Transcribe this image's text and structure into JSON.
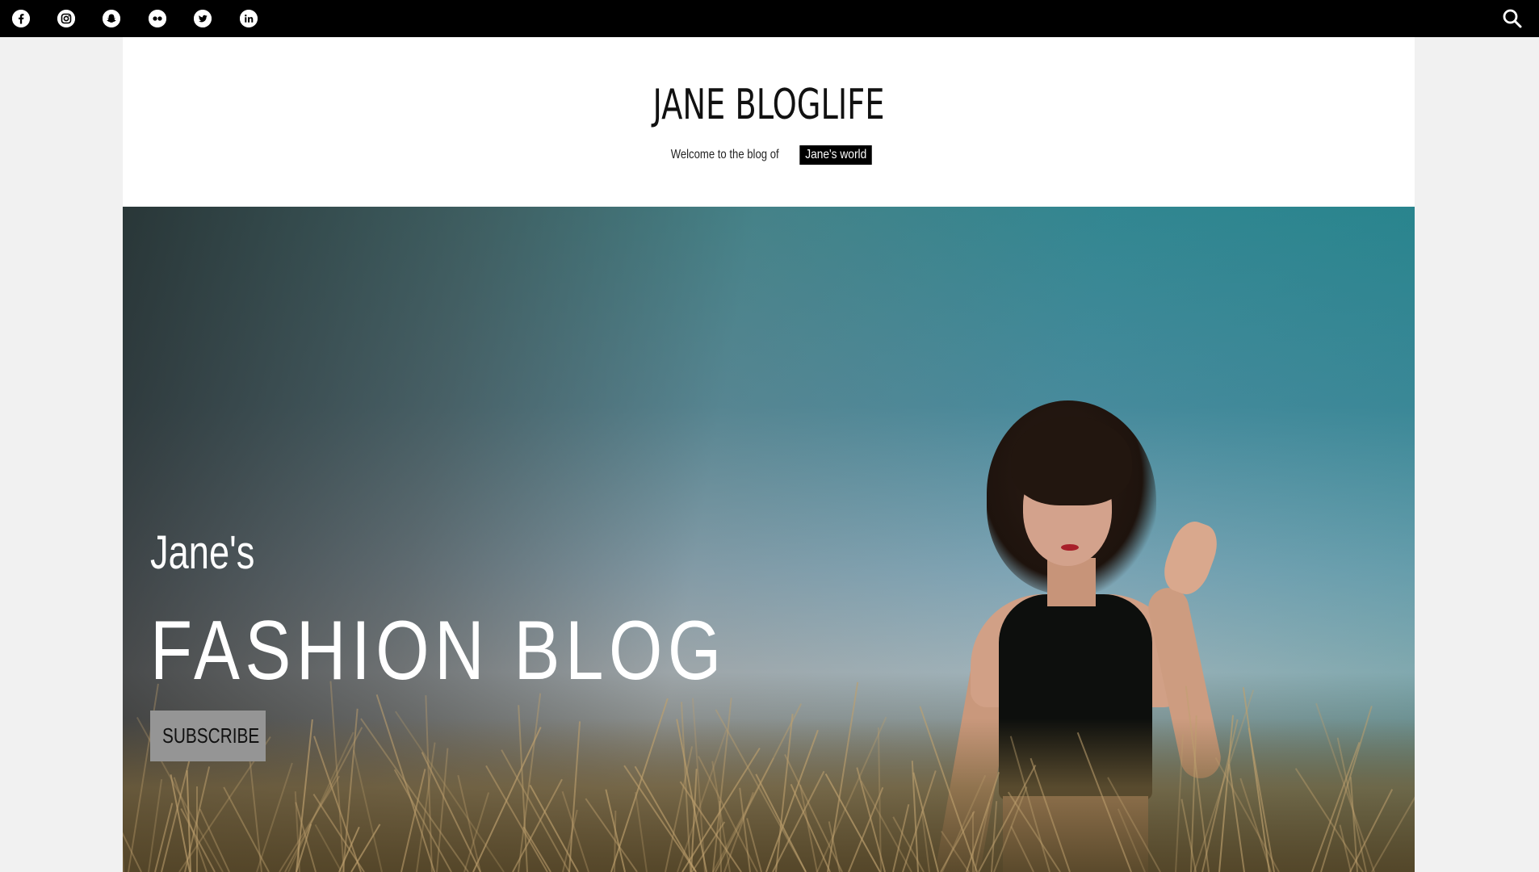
{
  "topbar": {
    "social": [
      {
        "name": "facebook"
      },
      {
        "name": "instagram"
      },
      {
        "name": "snapchat"
      },
      {
        "name": "flickr"
      },
      {
        "name": "twitter"
      },
      {
        "name": "linkedin"
      }
    ],
    "search_icon": "search-icon"
  },
  "header": {
    "title": "JANE BLOGLIFE",
    "tagline_prefix": "Welcome to the blog of",
    "tagline_badge": "Jane's world"
  },
  "hero": {
    "subtitle": "Jane's",
    "title": "FASHION BLOG",
    "button_label": "SUBSCRIBE"
  },
  "colors": {
    "topbar_bg": "#000000",
    "page_bg": "#f1f1f1",
    "header_bg": "#ffffff",
    "button_bg": "#959595"
  }
}
